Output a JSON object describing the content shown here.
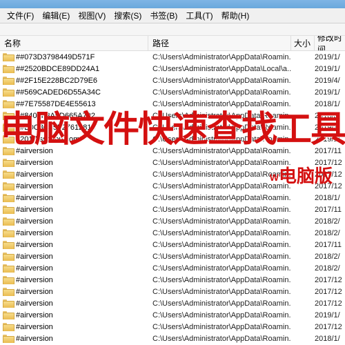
{
  "menu": {
    "file": "文件(F)",
    "edit": "编辑(E)",
    "view": "视图(V)",
    "search": "搜索(S)",
    "bookmark": "书签(B)",
    "tools": "工具(T)",
    "help": "帮助(H)"
  },
  "headers": {
    "name": "名称",
    "path": "路径",
    "size": "大小",
    "date": "修改时间"
  },
  "overlay": {
    "main": "电脑文件快速查找工具",
    "sub_prefix": "W",
    "sub": "电脑版"
  },
  "rows": [
    {
      "name": "##073D3798449D571F",
      "path": "C:\\Users\\Administrator\\AppData\\Roamin...",
      "date": "2019/1/"
    },
    {
      "name": "##2520BDCE89DD24A1",
      "path": "C:\\Users\\Administrator\\AppData\\Local\\a...",
      "date": "2019/1/"
    },
    {
      "name": "##2F15E228BC2D79E6",
      "path": "C:\\Users\\Administrator\\AppData\\Roamin...",
      "date": "2019/4/"
    },
    {
      "name": "##569CADED6D55A34C",
      "path": "C:\\Users\\Administrator\\AppData\\Roamin...",
      "date": "2019/1/"
    },
    {
      "name": "##7E75587DE4E55613",
      "path": "C:\\Users\\Administrator\\AppData\\Roamin...",
      "date": "2018/1/"
    },
    {
      "name": "##8402F3A5D665A702",
      "path": "C:\\Users\\Administrator\\AppData\\Roamin...",
      "date": "2018/3/"
    },
    {
      "name": "##B0C3C45F27612814",
      "path": "C:\\Users\\Administrator\\AppData\\Roamin...",
      "date": "2019/3/"
    },
    {
      "name": "#2017.ssceou.com",
      "path": "C:\\Users\\Administrator\\AppData\\Roamin...",
      "date": "2019/1/"
    },
    {
      "name": "#airversion",
      "path": "C:\\Users\\Administrator\\AppData\\Roamin...",
      "date": "2017/11"
    },
    {
      "name": "#airversion",
      "path": "C:\\Users\\Administrator\\AppData\\Roamin...",
      "date": "2017/12"
    },
    {
      "name": "#airversion",
      "path": "C:\\Users\\Administrator\\AppData\\Roamin...",
      "date": "2017/12"
    },
    {
      "name": "#airversion",
      "path": "C:\\Users\\Administrator\\AppData\\Roamin...",
      "date": "2017/12"
    },
    {
      "name": "#airversion",
      "path": "C:\\Users\\Administrator\\AppData\\Roamin...",
      "date": "2018/1/"
    },
    {
      "name": "#airversion",
      "path": "C:\\Users\\Administrator\\AppData\\Roamin...",
      "date": "2017/11"
    },
    {
      "name": "#airversion",
      "path": "C:\\Users\\Administrator\\AppData\\Roamin...",
      "date": "2018/2/"
    },
    {
      "name": "#airversion",
      "path": "C:\\Users\\Administrator\\AppData\\Roamin...",
      "date": "2018/2/"
    },
    {
      "name": "#airversion",
      "path": "C:\\Users\\Administrator\\AppData\\Roamin...",
      "date": "2017/11"
    },
    {
      "name": "#airversion",
      "path": "C:\\Users\\Administrator\\AppData\\Roamin...",
      "date": "2018/2/"
    },
    {
      "name": "#airversion",
      "path": "C:\\Users\\Administrator\\AppData\\Roamin...",
      "date": "2018/2/"
    },
    {
      "name": "#airversion",
      "path": "C:\\Users\\Administrator\\AppData\\Roamin...",
      "date": "2017/12"
    },
    {
      "name": "#airversion",
      "path": "C:\\Users\\Administrator\\AppData\\Roamin...",
      "date": "2017/12"
    },
    {
      "name": "#airversion",
      "path": "C:\\Users\\Administrator\\AppData\\Roamin...",
      "date": "2017/12"
    },
    {
      "name": "#airversion",
      "path": "C:\\Users\\Administrator\\AppData\\Roamin...",
      "date": "2019/1/"
    },
    {
      "name": "#airversion",
      "path": "C:\\Users\\Administrator\\AppData\\Roamin...",
      "date": "2017/12"
    },
    {
      "name": "#airversion",
      "path": "C:\\Users\\Administrator\\AppData\\Roamin...",
      "date": "2018/1/"
    }
  ]
}
